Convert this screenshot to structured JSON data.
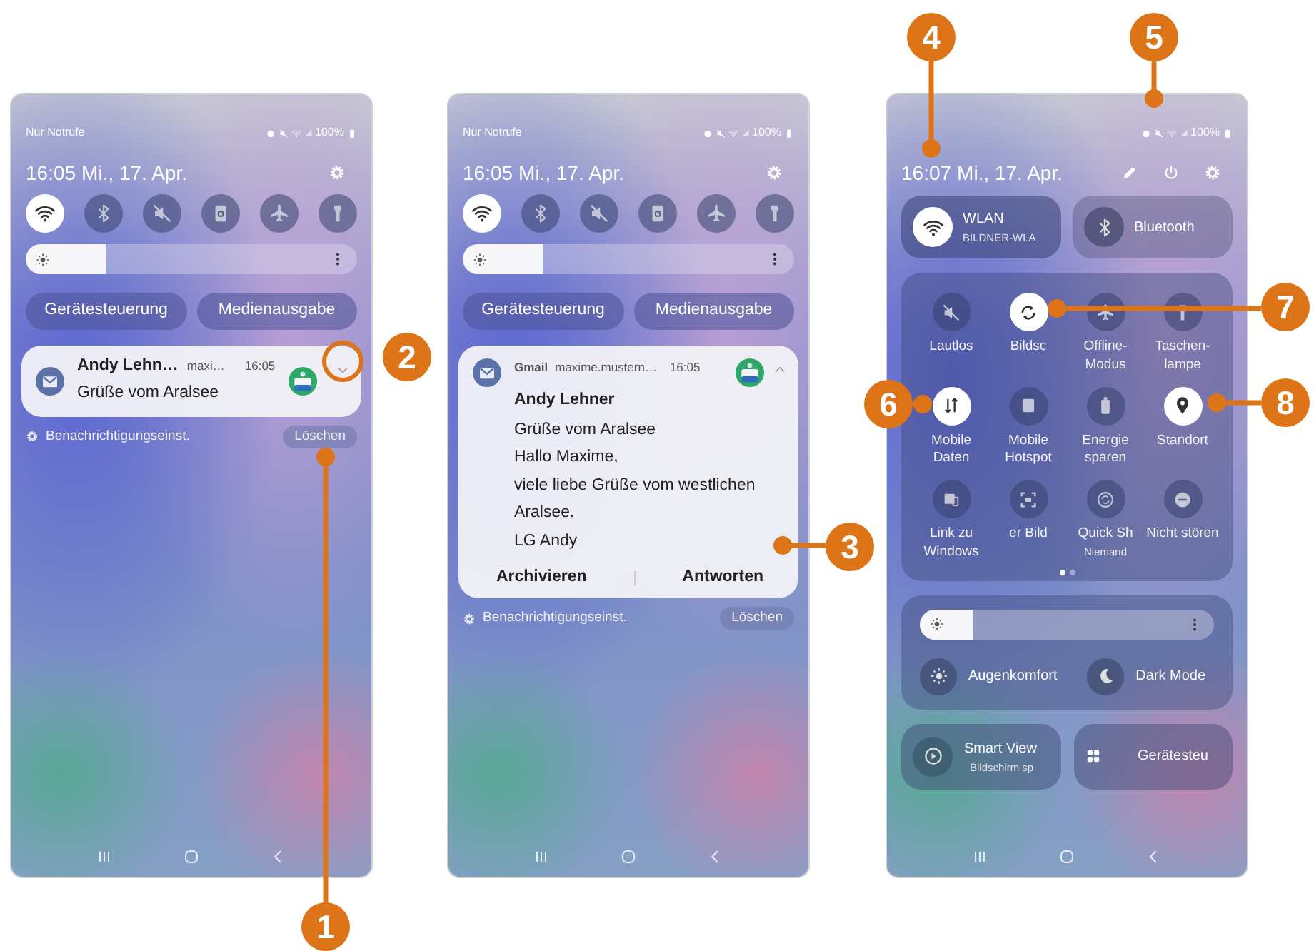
{
  "phones": [
    {
      "kind": "notifications",
      "status": {
        "label": "Nur Notrufe",
        "battery": "100%"
      },
      "clock": {
        "time": "16:05",
        "date": "Mi., 17. Apr."
      },
      "quick_toggles": [
        {
          "on": true
        },
        {
          "on": false
        },
        {
          "on": false
        },
        {
          "on": false
        },
        {
          "on": false
        },
        {
          "on": false
        }
      ],
      "brightness": {
        "level": 0.24
      },
      "buttons": [
        "Gerätesteuerung",
        "Medienausgabe"
      ],
      "notification": {
        "expanded": false,
        "sender": "Andy Lehn…",
        "account": "maxi…",
        "time": "16:05",
        "lines": [
          "Grüße vom Aralsee"
        ]
      },
      "footer": {
        "settings": "Benachrichtigungseinst.",
        "clear": "Löschen"
      }
    },
    {
      "kind": "notifications",
      "status": {
        "label": "Nur Notrufe",
        "battery": "100%"
      },
      "clock": {
        "time": "16:05",
        "date": "Mi., 17. Apr."
      },
      "quick_toggles": [
        {
          "on": true
        },
        {
          "on": false
        },
        {
          "on": false
        },
        {
          "on": false
        },
        {
          "on": false
        },
        {
          "on": false
        }
      ],
      "brightness": {
        "level": 0.24
      },
      "buttons": [
        "Gerätesteuerung",
        "Medienausgabe"
      ],
      "notification": {
        "expanded": true,
        "app": "Gmail",
        "account": "maxime.mustern…",
        "time": "16:05",
        "sender": "Andy Lehner",
        "lines": [
          "Grüße vom Aralsee",
          "Hallo Maxime,",
          "viele liebe Grüße vom westlichen Aralsee.",
          "LG Andy"
        ],
        "actions": [
          "Archivieren",
          "Antworten"
        ]
      },
      "footer": {
        "settings": "Benachrichtigungseinst.",
        "clear": "Löschen"
      }
    },
    {
      "kind": "quick_panel",
      "status": {
        "battery": "100%"
      },
      "clock": {
        "time": "16:07",
        "date": "Mi., 17. Apr."
      },
      "wide_tiles": [
        {
          "label": "WLAN",
          "sublabel": "BILDNER-WLA",
          "on": true
        },
        {
          "label": "Bluetooth",
          "on": false
        }
      ],
      "tiles": [
        {
          "label": "Lautlos",
          "on": false
        },
        {
          "label": "Bildsc",
          "on": true
        },
        {
          "label": "Offline-Modus",
          "on": false
        },
        {
          "label": "Taschen-lampe",
          "on": false
        },
        {
          "label": "Mobile Daten",
          "on": true
        },
        {
          "label": "Mobile Hotspot",
          "on": false
        },
        {
          "label": "Energie sparen",
          "on": false
        },
        {
          "label": "Standort",
          "on": true
        },
        {
          "label": "Link zu Windows",
          "on": false
        },
        {
          "label": "er Bild",
          "on": false
        },
        {
          "label": "Quick Sh",
          "sublabel": "Niemand",
          "on": false
        },
        {
          "label": "Nicht stören",
          "on": false
        }
      ],
      "pages": [
        {
          "selected": true
        },
        {
          "selected": false
        }
      ],
      "brightness": {
        "level": 0.18
      },
      "display_modes": [
        {
          "label": "Augenkomfort",
          "on": false
        },
        {
          "label": "Dark Mode",
          "on": false
        }
      ],
      "shortcuts": [
        {
          "label": "Smart View",
          "sublabel": "Bildschirm sp"
        },
        {
          "label": "Gerätesteu"
        }
      ]
    }
  ],
  "callouts": [
    {
      "label": "1"
    },
    {
      "label": "2"
    },
    {
      "label": "3"
    },
    {
      "label": "4"
    },
    {
      "label": "5"
    },
    {
      "label": "6"
    },
    {
      "label": "7"
    },
    {
      "label": "8"
    }
  ]
}
